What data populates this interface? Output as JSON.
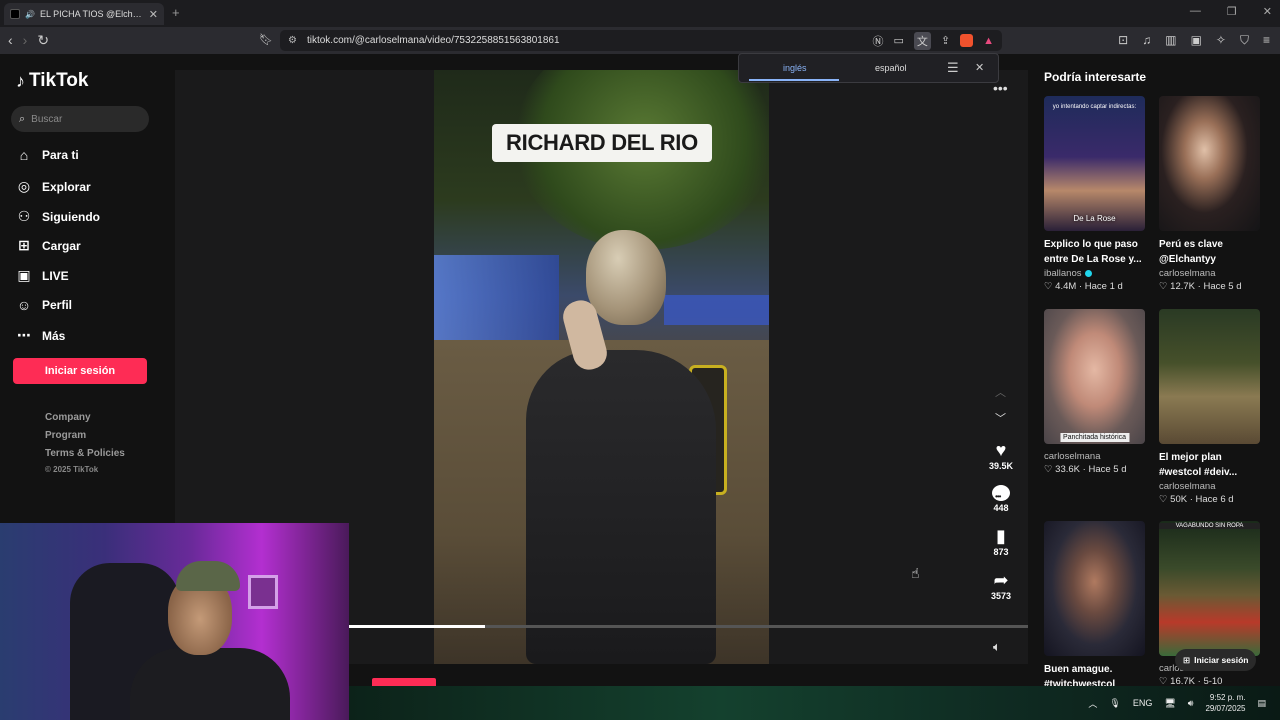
{
  "browser": {
    "tab_title": "EL PICHA TIOS @Elchantyy | ",
    "url": "tiktok.com/@carloselmana/video/7532258851563801861"
  },
  "translate": {
    "source_lang": "inglés",
    "target_lang": "español"
  },
  "tiktok": {
    "logo_text": "TikTok",
    "search_placeholder": "Buscar",
    "nav": [
      "Para ti",
      "Explorar",
      "Siguiendo",
      "Cargar",
      "LIVE",
      "Perfil",
      "Más"
    ],
    "login_label": "Iniciar sesión",
    "footer": [
      "Company",
      "Program",
      "Terms & Policies"
    ],
    "copyright": "© 2025 TikTok"
  },
  "video": {
    "caption": "RICHARD DEL RIO",
    "likes": "39.5K",
    "comments": "448",
    "saves": "873",
    "shares": "3573",
    "progress_pct": 20
  },
  "recommendations": {
    "title": "Podría interesarte",
    "items": [
      {
        "title": "Explico lo que paso entre De La Rose y...",
        "author": "iballanos",
        "verified": true,
        "likes": "4.4M",
        "age": "Hace 1 d",
        "overlay_top": "yo intentando captar indirectas:",
        "overlay_bottom": "De La Rose"
      },
      {
        "title": "Perú es clave @Elchantyy",
        "author": "carloselmana",
        "verified": false,
        "likes": "12.7K",
        "age": "Hace 5 d",
        "overlay_top": "",
        "overlay_bottom": ""
      },
      {
        "title": "",
        "author": "carloselmana",
        "verified": false,
        "likes": "33.6K",
        "age": "Hace 5 d",
        "overlay_top": "",
        "overlay_bottom": "Panchitada histórica"
      },
      {
        "title": "El mejor plan #westcol #deiv...",
        "author": "carloselmana",
        "verified": false,
        "likes": "50K",
        "age": "Hace 6 d",
        "overlay_top": "",
        "overlay_bottom": ""
      },
      {
        "title": "Buen amague. #twitchwestcol",
        "author": "",
        "verified": false,
        "likes": "",
        "age": "",
        "overlay_top": "",
        "overlay_bottom": ""
      },
      {
        "title": "",
        "author": "carloselmana",
        "verified": false,
        "likes": "16.7K",
        "age": "5-10",
        "overlay_top": "VAGABUNDO SIN ROPA",
        "overlay_bottom": ""
      }
    ],
    "login_pill": "Iniciar sesión"
  },
  "taskbar": {
    "lang": "ENG",
    "time": "9:52 p. m.",
    "date": "29/07/2025"
  }
}
